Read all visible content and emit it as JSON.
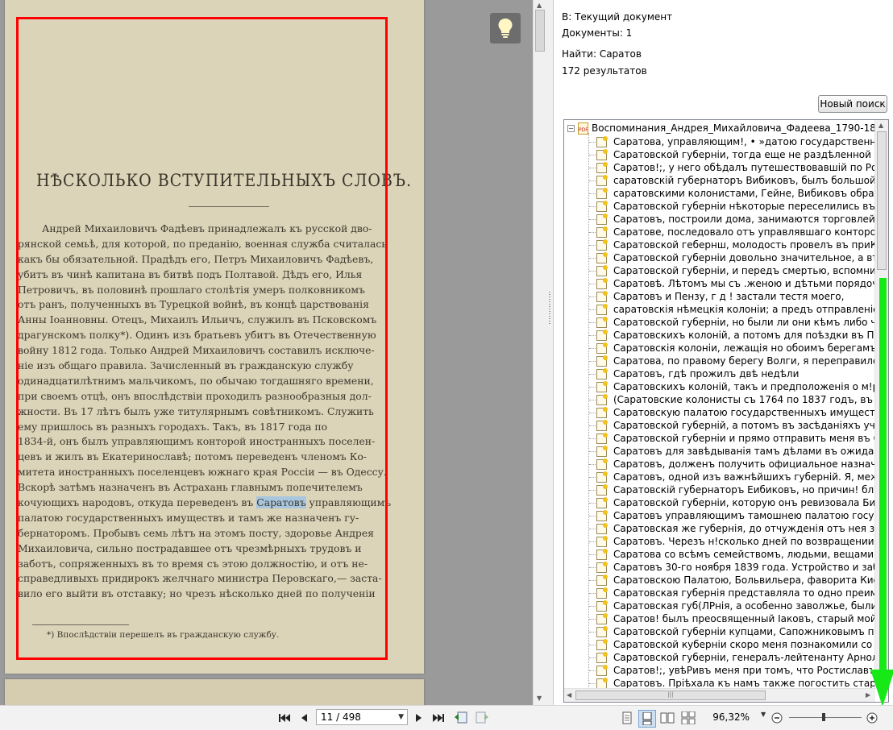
{
  "viewer": {
    "page_heading": "НѢСКОЛЬКО ВСТУПИТЕЛЬНЫХЪ СЛОВЪ.",
    "highlighted_term": "Саратовъ",
    "body_lines": [
      {
        "indent": true,
        "text": "Андрей Михаиловичъ Фадѣевъ принадлежалъ къ русской дво-"
      },
      {
        "indent": false,
        "text": "рянской семьѣ, для которой, по преданію, военная служба считалась"
      },
      {
        "indent": false,
        "text": "какъ бы обязательной. Прадѣдъ его, Петръ Михаиловичъ Фадѣевъ,"
      },
      {
        "indent": false,
        "text": "убитъ въ чинѣ капитана въ битвѣ подъ Полтавой. Дѣдъ его, Илья"
      },
      {
        "indent": false,
        "text": "Петровичъ, въ половинѣ прошлаго столѣтія умеръ полковникомъ"
      },
      {
        "indent": false,
        "text": "отъ ранъ, полученныхъ въ Турецкой войнѣ, въ концѣ царствованія"
      },
      {
        "indent": false,
        "text": "Анны Іоанновны. Отецъ, Михаилъ Ильичъ, служилъ въ Псковскомъ"
      },
      {
        "indent": false,
        "text": "драгунскомъ полку*). Одинъ изъ братьевъ убитъ въ Отечественную"
      },
      {
        "indent": false,
        "text": "войну 1812 года. Только Андрей Михаиловичъ составилъ исключе-"
      },
      {
        "indent": false,
        "text": "ніе изъ общаго правила. Зачисленный въ гражданскую службу"
      },
      {
        "indent": false,
        "text": "одинадцатилѣтнимъ мальчикомъ, по обычаю тогдашняго времени,"
      },
      {
        "indent": false,
        "text": "при своемъ отцѣ, онъ впослѣдствіи проходилъ разнообразныя дол-"
      },
      {
        "indent": false,
        "text": "жности. Въ 17 лѣтъ былъ уже титулярнымъ совѣтникомъ. Служить"
      },
      {
        "indent": false,
        "text": "ему пришлось въ разныхъ городахъ. Такъ, въ 1817 года по"
      },
      {
        "indent": false,
        "text": "1834-й, онъ былъ управляющимъ конторой иностранныхъ поселен-"
      },
      {
        "indent": false,
        "text": "цевъ и жилъ въ Екатеринославѣ; потомъ переведенъ членомъ Ко-"
      },
      {
        "indent": false,
        "text": "митета иностранныхъ поселенцевъ южнаго края Россіи — въ Одессу."
      },
      {
        "indent": false,
        "text": "Вскорѣ затѣмъ назначенъ въ Астрахань главнымъ попечителемъ"
      },
      {
        "indent": false,
        "pre": "кочующихъ народовъ, откуда переведенъ въ ",
        "post": " управляющимъ"
      },
      {
        "indent": false,
        "text": "палатою государственныхъ имуществъ и тамъ же назначенъ гу-"
      },
      {
        "indent": false,
        "text": "бернаторомъ. Пробывъ семь лѣтъ на этомъ посту, здоровье Андрея"
      },
      {
        "indent": false,
        "text": "Михаиловича, сильно пострадавшее отъ чрезмѣрныхъ трудовъ и"
      },
      {
        "indent": false,
        "text": "заботъ, сопряженныхъ въ то время съ этою должностію, и отъ не-"
      },
      {
        "indent": false,
        "text": "справедливыхъ придирокъ желчнаго министра Перовскаго,— заста-"
      },
      {
        "indent": false,
        "text": "вило его выйти въ отставку; но чрезъ нѣсколько дней по полученіи"
      }
    ],
    "footnote": "*) Впослѣдствіи перешелъ въ гражданскую службу."
  },
  "search": {
    "in_label": "В: Текущий документ",
    "documents_label": "Документы: 1",
    "find_label": "Найти: Саратов",
    "results_count": "172 результатов",
    "new_search_button": "Новый поиск",
    "tree_root": "Воспоминания_Андрея_Михайловича_Фадеева_1790-1867_",
    "results": [
      "Саратова, управляющим!, • »датою государственных!,",
      "Саратовской губерніи, тогда еще не раздѣленной и вмѣ",
      "Саратов!;, у него обѣдалъ путешествовавшій по Россіп",
      "саратовскій губернаторъ Вибиковъ, былъ большой охотн",
      "саратовскими колонистами, Гейне, Вибиковъ обратился",
      "Саратовской губерніи нѣкоторые переселились въ Сара",
      "Саратовъ, построили дома, занимаются торговлей и сдѣ",
      "Саратове, последовало отъ управлявшаго конторою кол",
      "Саратовской гебернш, молодость провелъ въ приКазном",
      "Саратовской губерніи довольно значительное, а въ Астр",
      "Саратовской губерніи, и передъ смертью, вспомнивъ сво",
      "Саратовѣ. Лѣтомъ мы съ .женою и дѣтьми порядочно с",
      "Саратовъ и Пензу, г д ! застали тестя моего,",
      "саратовскія нѣмецкія колоніи; а предъ отправленіемъ Н",
      "Саратовской губерніи, но были ли они кѣмъ либо читан",
      "Саратовскихъ колоній, а потомъ для поѣздки въ Петерб",
      "Саратовскія колоніи, лежащія но обоимъ берегамъ Волг",
      "Саратова, по правому берегу Волги, я переправился на",
      "Саратовъ, гдѣ прожилъ двѣ недѣли",
      "Саратовскихъ колоній, такъ и предположенія о м!рахъ к",
      "(Саратовские колонисты съ 1764 по 1837 годъ, въ семь",
      "Саратовскую палатою государственныхъ имуществъ ; но",
      "Саратовской губерній, а потомъ въ засѣданіяхъ учрежде",
      "Саратовской губерніи и прямо отправить меня въ Сарат",
      "Саратовъ для завѣдыванія тамъ дѣлами въ ожиданіи отк",
      "Саратовъ, долженъ получить официальное назначение п",
      "Саратовъ, одной изъ важнѣйшихъ губерній. Я, между тѣ",
      "Саратовскій губернаторъ Еибиковъ, но причин! близост",
      "Саратовской губерніи, которую онъ ревизовала Бибиков",
      "Саратовъ управляющимъ тамошнею палатою государств",
      "Саратовская же губернія, до отчужденія отъ нея заволж",
      "Саратовъ. Черезъ н!сколько дней по возвращении моемъ",
      "Саратова со всѣмъ семействомъ, людьми, вещами, экип",
      "Саратовъ 30-го ноября 1839 года. Устройство и заботы",
      "Саратовскою Палатою, Больвильера, фаворита Киселев",
      "Саратовская губернія представляла то одно преимущес",
      "Саратовская губ(ЛРнія, а особенно заволжье, были гн!",
      "Саратов! былъ преосвященный Іаковъ, старый мой знако",
      "Саратовской губерніи купцами, Сапожниковымъ п Курса",
      "Саратовской куберніи скоро меня познакомили со всѣмі",
      "Саратовской губерніи, генералъ-лейтенанту Арнольди",
      "Саратов!;, увѣРивъ меня при томъ, что Ростиславъ мал",
      "Саратовъ. Пріѣхала къ намъ также погостить старшая до"
    ]
  },
  "toolbar": {
    "page_value": "11 / 498",
    "zoom_value": "96,32%"
  },
  "colors": {
    "frame_highlight": "#ff0000",
    "annotation_arrow": "#16e916",
    "term_highlight": "#a9c6df",
    "page_paper": "#dcd4b8"
  },
  "icons": {
    "hint": "lightbulb-icon",
    "first": "first-page-icon",
    "prev": "prev-page-icon",
    "next": "next-page-icon",
    "last": "last-page-icon",
    "zoom_out": "zoom-out-icon",
    "zoom_in": "zoom-in-icon"
  }
}
